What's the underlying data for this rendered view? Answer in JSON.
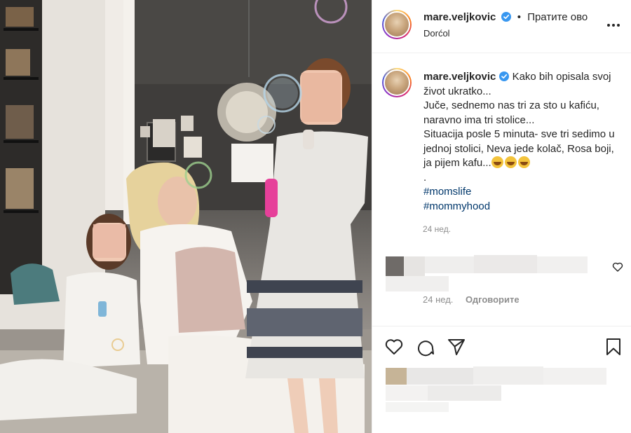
{
  "post": {
    "username": "mare.veljkovic",
    "separator": "•",
    "follow_label": "Пратите ово",
    "location": "Dorćol",
    "caption_lines": [
      "Kako bih opisala svoj",
      "život ukratko...",
      "Juče, sednemo nas tri za sto u kafiću,",
      "naravno ima tri stolice...",
      "Situacija posle 5 minuta- sve tri sedimo u",
      "jednoj stolici, Neva jede kolač, Rosa boji,",
      "ja pijem kafu...",
      "."
    ],
    "hashtags": [
      "#momslife",
      "#mommyhood"
    ],
    "time": "24 нед."
  },
  "comment": {
    "time": "24 нед.",
    "reply_label": "Одговорите"
  },
  "icons": {
    "verified": "verified-badge-icon",
    "more": "more-options-icon",
    "like": "heart-icon",
    "comment": "comment-icon",
    "share": "share-icon",
    "save": "bookmark-icon"
  },
  "colors": {
    "verified": "#3897f0",
    "hashtag": "#00376b",
    "muted": "#8e8e8e"
  }
}
